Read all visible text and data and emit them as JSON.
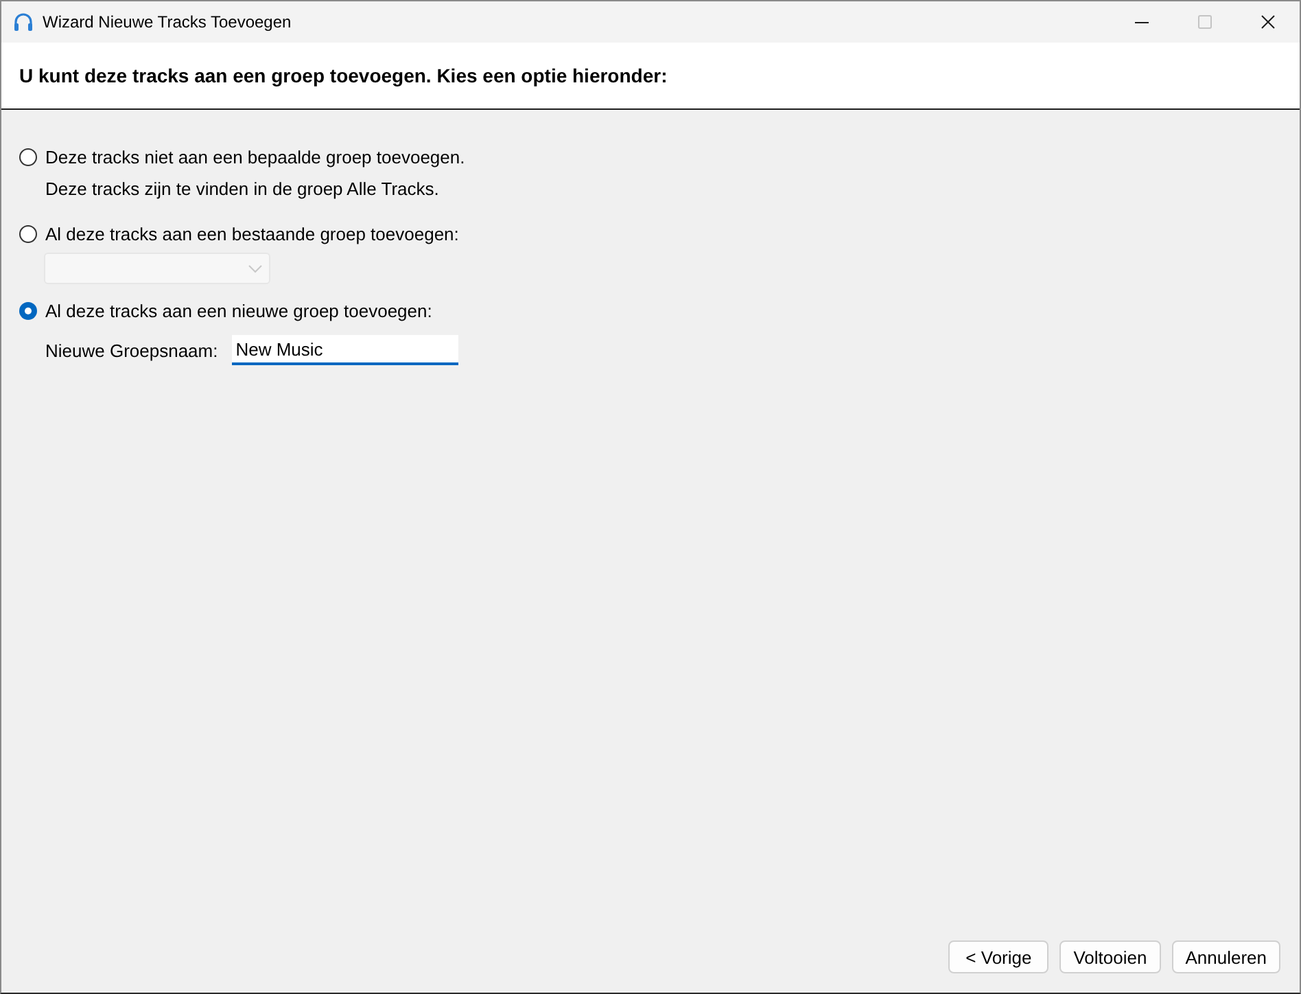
{
  "window": {
    "title": "Wizard Nieuwe Tracks Toevoegen",
    "maximize_disabled": true
  },
  "header": {
    "text": "U kunt deze tracks aan een groep toevoegen. Kies een optie hieronder:"
  },
  "options": [
    {
      "kind": "note",
      "label": "Deze tracks niet aan een bepaalde groep toevoegen.",
      "selected": false,
      "note": "Deze tracks zijn te vinden in de groep Alle Tracks."
    },
    {
      "kind": "dropdown",
      "label": "Al deze tracks aan een bestaande groep toevoegen:",
      "selected": false,
      "dropdown": {
        "disabled": true
      }
    },
    {
      "kind": "field",
      "label": "Al deze tracks aan een nieuwe groep toevoegen:",
      "selected": true,
      "field": {
        "label": "Nieuwe Groepsnaam:",
        "value": "New Music",
        "focused": true
      }
    }
  ],
  "buttons": [
    {
      "label": "< Vorige"
    },
    {
      "label": "Voltooien"
    },
    {
      "label": "Annuleren"
    }
  ]
}
